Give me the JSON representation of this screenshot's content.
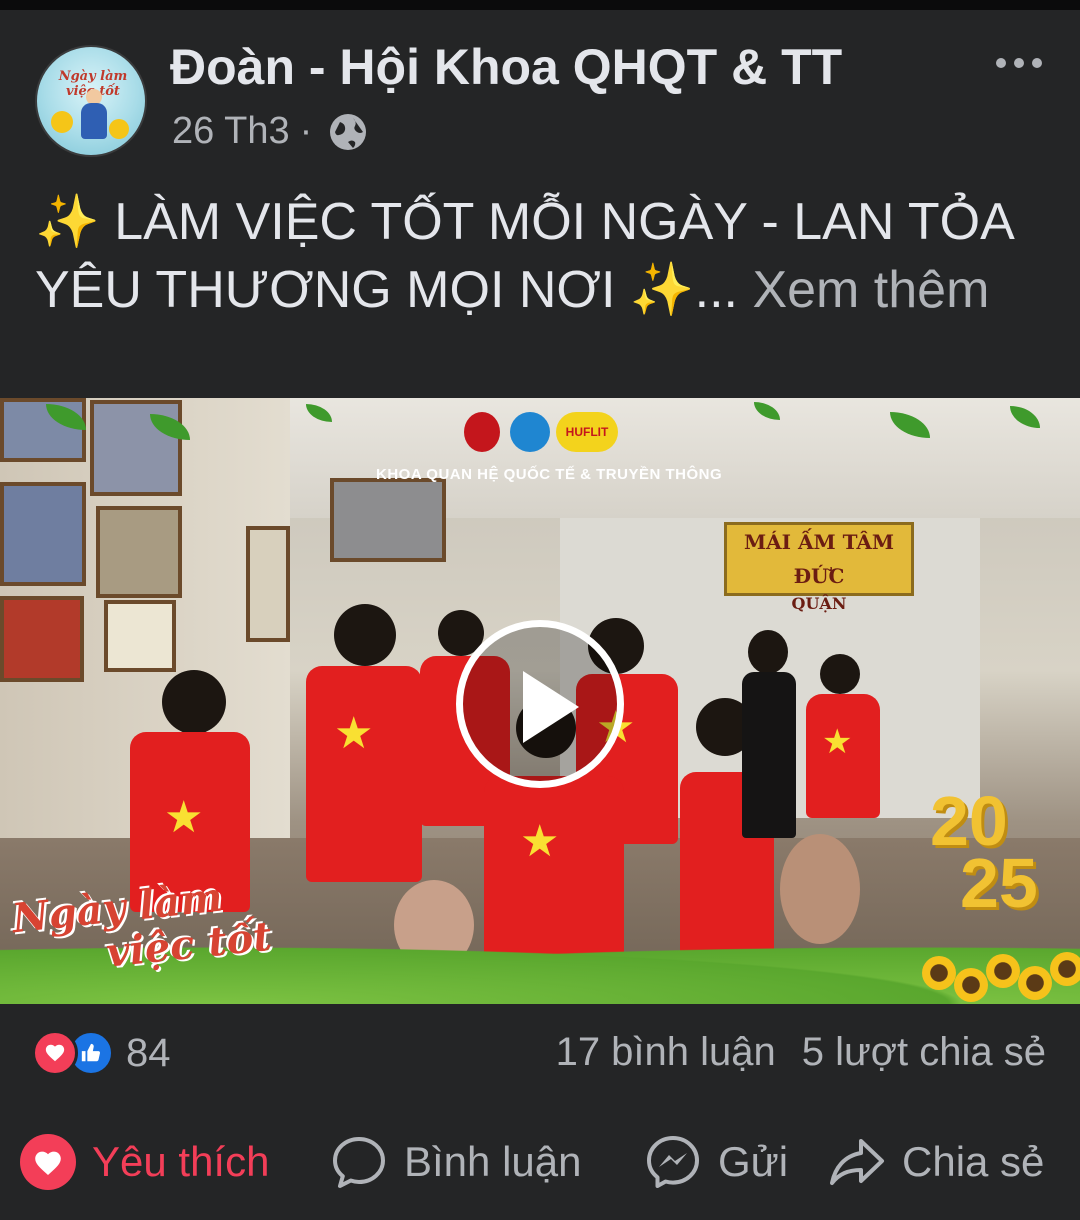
{
  "post": {
    "page_name": "Đoàn - Hội Khoa QHQT & TT",
    "date": "26 Th3",
    "separator": "·",
    "audience_icon": "globe-icon",
    "avatar_text": "Ngày làm việc tốt",
    "caption_sparkle": "✨",
    "caption_text_1": " LÀM VIỆC TỐT MỖI NGÀY - LAN TỎA YÊU THƯƠNG MỌI NƠI ",
    "caption_sparkle_end": "✨",
    "caption_ellipsis": "... ",
    "see_more": "Xem thêm"
  },
  "video": {
    "org_line": "KHOA QUAN HỆ QUỐC TẾ & TRUYỀN THÔNG",
    "logo_label": "HUFLIT",
    "sign_text": "MÁI ẤM TÂM ĐỨC",
    "sign_sub": "QUẬN",
    "event_title_1": "Ngày làm",
    "event_title_2": "việc tốt",
    "year_top": "20",
    "year_bottom": "25",
    "play_icon": "play-icon"
  },
  "engagement": {
    "reaction_icons": [
      "heart-icon",
      "like-icon"
    ],
    "reaction_count": "84",
    "comments": "17 bình luận",
    "shares": "5 lượt chia sẻ"
  },
  "actions": {
    "like": "Yêu thích",
    "comment": "Bình luận",
    "send": "Gửi",
    "share": "Chia sẻ",
    "liked_color": "#f33e58"
  }
}
